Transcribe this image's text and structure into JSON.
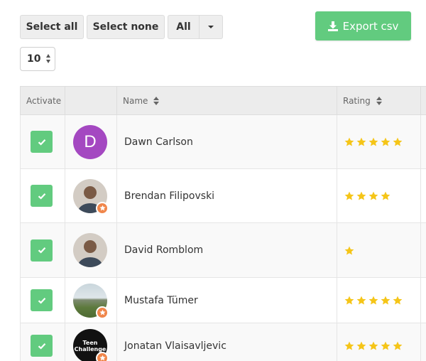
{
  "toolbar": {
    "select_all_label": "Select all",
    "select_none_label": "Select none",
    "filter_selected": "All",
    "export_label": "Export csv",
    "export_icon": "download-icon",
    "per_page_value": "10"
  },
  "colors": {
    "accent_green": "#62cb7f",
    "star_yellow": "#f5c518",
    "badge_orange": "#f0864b",
    "header_bg": "#ececec"
  },
  "table": {
    "columns": [
      "Activate",
      "",
      "Name",
      "Rating"
    ],
    "rows": [
      {
        "name": "Dawn Carlson",
        "rating": 5,
        "activated": true,
        "avatar": {
          "type": "letter",
          "letter": "D",
          "color": "#a448c1"
        },
        "badge": false
      },
      {
        "name": "Brendan Filipovski",
        "rating": 4,
        "activated": true,
        "avatar": {
          "type": "photo",
          "icon": "person-photo-icon"
        },
        "badge": true
      },
      {
        "name": "David Romblom",
        "rating": 1,
        "activated": true,
        "avatar": {
          "type": "photo",
          "icon": "person-photo-icon"
        },
        "badge": false
      },
      {
        "name": "Mustafa Tümer",
        "rating": 5,
        "activated": true,
        "avatar": {
          "type": "photo",
          "icon": "landscape-photo-icon"
        },
        "badge": true
      },
      {
        "name": "Jonatan Vlaisavljevic",
        "rating": 5,
        "activated": true,
        "avatar": {
          "type": "logo",
          "icon": "teen-challenge-logo-icon",
          "text_line1": "Teen",
          "text_line2": "Challenge"
        },
        "badge": true
      }
    ]
  }
}
